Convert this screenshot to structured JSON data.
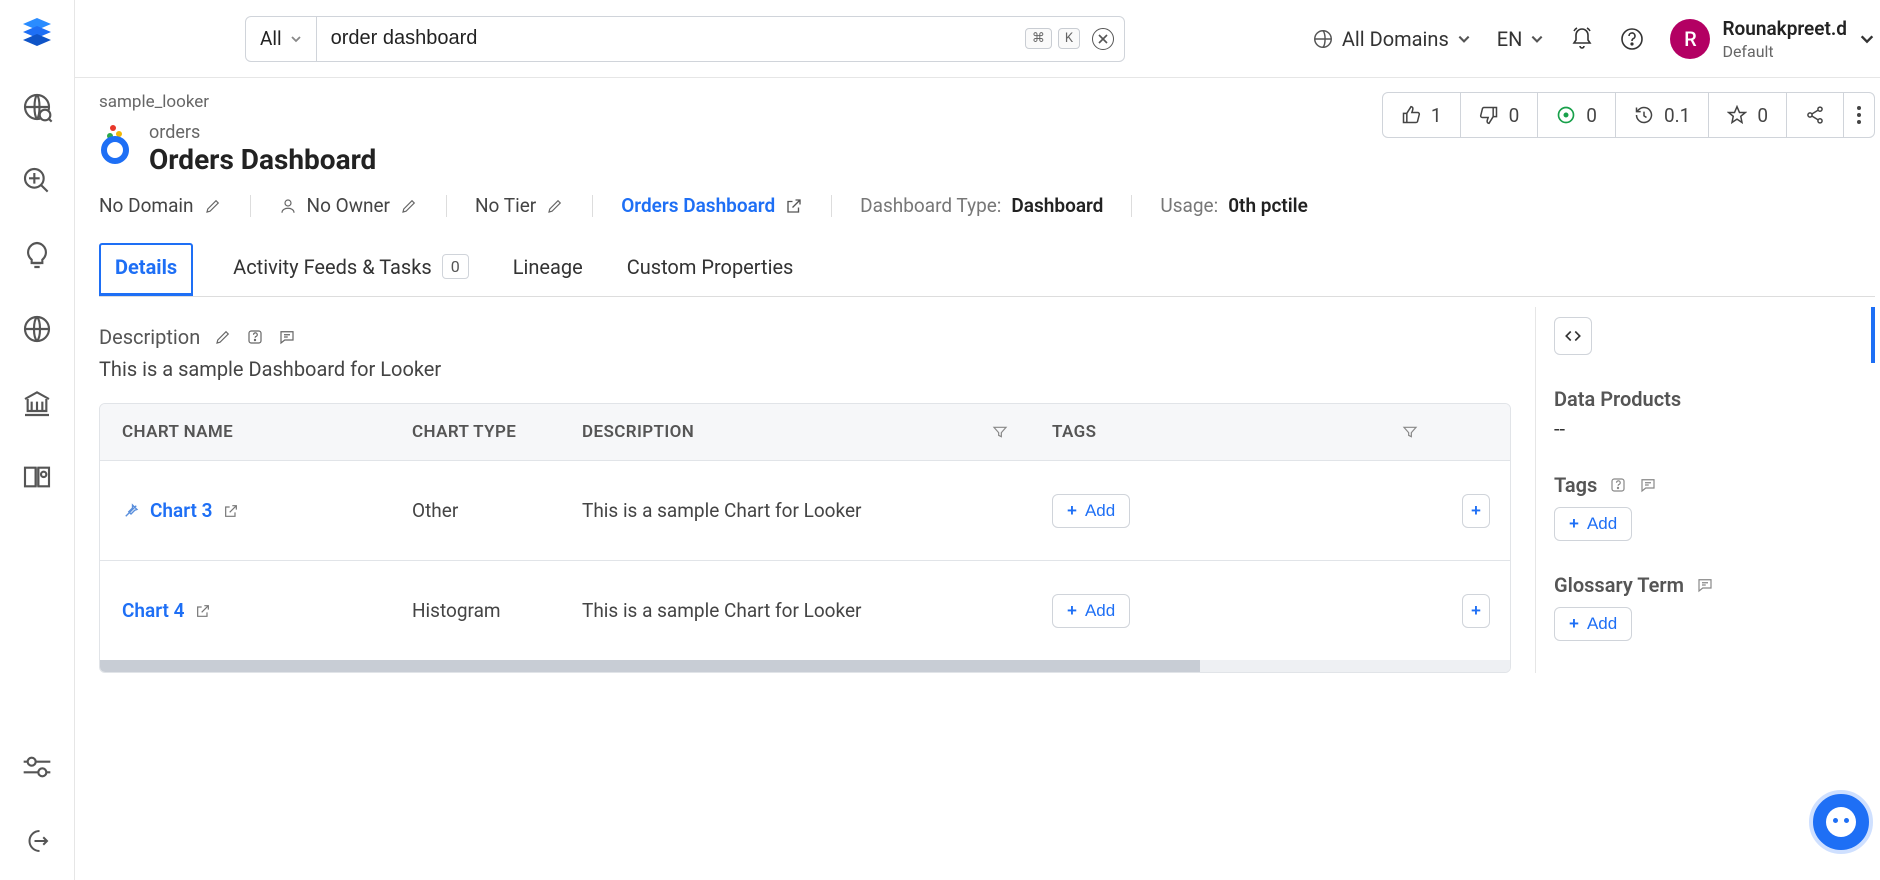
{
  "search": {
    "select_label": "All",
    "query": "order dashboard",
    "shortcut_keys": [
      "⌘",
      "K"
    ]
  },
  "header": {
    "domains_label": "All Domains",
    "lang": "EN",
    "user_initial": "R",
    "user_name": "Rounakpreet.d",
    "user_role": "Default"
  },
  "breadcrumb": "sample_looker",
  "asset": {
    "super": "orders",
    "title": "Orders Dashboard"
  },
  "actions": {
    "like": "1",
    "dislike": "0",
    "issues": "0",
    "recent": "0.1",
    "star": "0"
  },
  "meta": {
    "domain": "No Domain",
    "owner": "No Owner",
    "tier": "No Tier",
    "dashboard_link": "Orders Dashboard",
    "type_label": "Dashboard Type:",
    "type_value": "Dashboard",
    "usage_label": "Usage:",
    "usage_value": "0th pctile"
  },
  "tabs": {
    "details": "Details",
    "activity": "Activity Feeds & Tasks",
    "activity_count": "0",
    "lineage": "Lineage",
    "custom": "Custom Properties"
  },
  "description": {
    "label": "Description",
    "text": "This is a sample Dashboard for Looker"
  },
  "table": {
    "headers": {
      "name": "CHART NAME",
      "type": "CHART TYPE",
      "desc": "DESCRIPTION",
      "tags": "TAGS"
    },
    "rows": [
      {
        "name": "Chart 3",
        "type": "Other",
        "desc": "This is a sample Chart for Looker"
      },
      {
        "name": "Chart 4",
        "type": "Histogram",
        "desc": "This is a sample Chart for Looker"
      }
    ],
    "add_label": "Add"
  },
  "right": {
    "data_products_label": "Data Products",
    "data_products_value": "--",
    "tags_label": "Tags",
    "glossary_label": "Glossary Term",
    "add_label": "Add"
  }
}
